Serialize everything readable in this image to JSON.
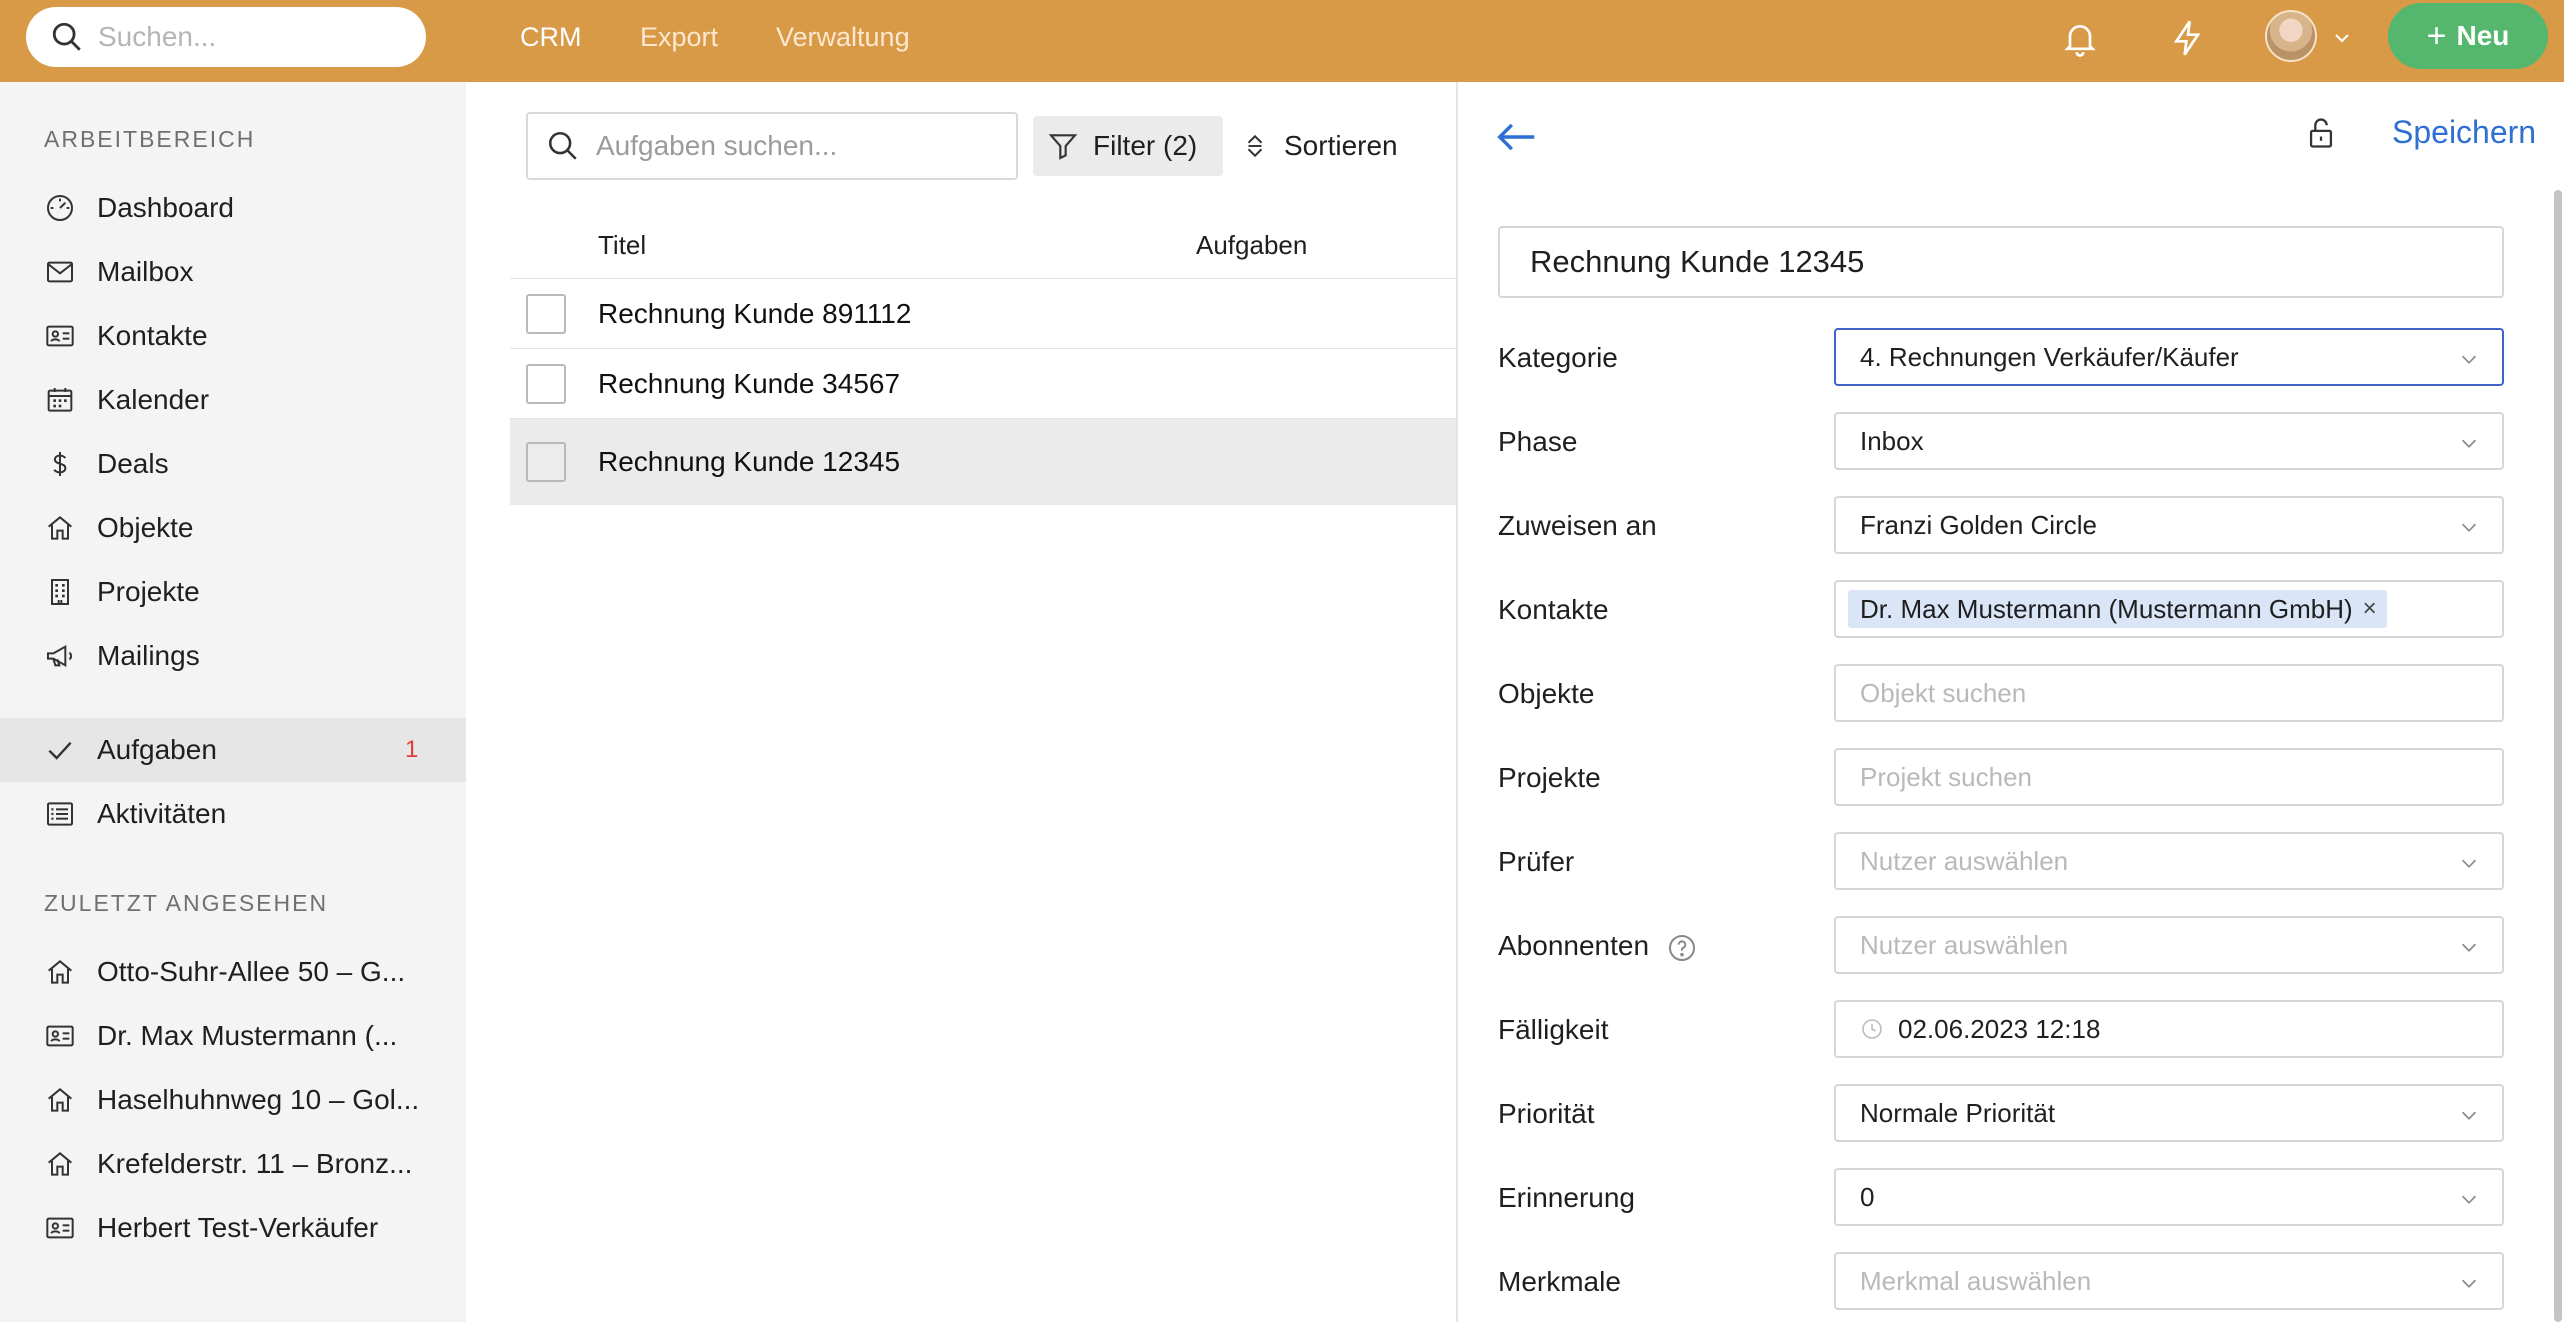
{
  "topbar": {
    "search_placeholder": "Suchen...",
    "nav": [
      "CRM",
      "Export",
      "Verwaltung"
    ],
    "new_button": "Neu"
  },
  "sidebar": {
    "workspace_title": "ARBEITBEREICH",
    "items": [
      {
        "label": "Dashboard",
        "icon": "dashboard-gauge-icon"
      },
      {
        "label": "Mailbox",
        "icon": "mail-icon"
      },
      {
        "label": "Kontakte",
        "icon": "contact-card-icon"
      },
      {
        "label": "Kalender",
        "icon": "calendar-icon"
      },
      {
        "label": "Deals",
        "icon": "dollar-icon"
      },
      {
        "label": "Objekte",
        "icon": "home-icon"
      },
      {
        "label": "Projekte",
        "icon": "building-icon"
      },
      {
        "label": "Mailings",
        "icon": "megaphone-icon"
      }
    ],
    "tasks": {
      "label": "Aufgaben",
      "badge": "1",
      "icon": "check-icon"
    },
    "activities": {
      "label": "Aktivitäten",
      "icon": "list-icon"
    },
    "recent_title": "ZULETZT ANGESEHEN",
    "recent": [
      {
        "label": "Otto-Suhr-Allee 50 – G...",
        "icon": "home-icon"
      },
      {
        "label": "Dr. Max Mustermann (...",
        "icon": "contact-card-icon"
      },
      {
        "label": "Haselhuhnweg 10 – Gol...",
        "icon": "home-icon"
      },
      {
        "label": "Krefelderstr. 11 – Bronz...",
        "icon": "home-icon"
      },
      {
        "label": "Herbert Test-Verkäufer",
        "icon": "contact-card-icon"
      }
    ]
  },
  "list": {
    "search_placeholder": "Aufgaben suchen...",
    "filter_label": "Filter (2)",
    "sort_label": "Sortieren",
    "columns": [
      "Titel",
      "Aufgaben"
    ],
    "rows": [
      "Rechnung Kunde 891112",
      "Rechnung Kunde 34567",
      "Rechnung Kunde 12345"
    ]
  },
  "detail": {
    "save_label": "Speichern",
    "title_value": "Rechnung Kunde 12345",
    "labels": {
      "kategorie": "Kategorie",
      "phase": "Phase",
      "zuweisen": "Zuweisen an",
      "kontakte": "Kontakte",
      "objekte": "Objekte",
      "projekte": "Projekte",
      "pruefer": "Prüfer",
      "abonnenten": "Abonnenten",
      "faelligkeit": "Fälligkeit",
      "prioritaet": "Priorität",
      "erinnerung": "Erinnerung",
      "merkmale": "Merkmale"
    },
    "values": {
      "kategorie": "4. Rechnungen Verkäufer/Käufer",
      "phase": "Inbox",
      "zuweisen": "Franzi Golden Circle",
      "kontakt_chip": "Dr. Max Mustermann (Mustermann GmbH)",
      "faelligkeit": "02.06.2023 12:18",
      "prioritaet": "Normale Priorität",
      "erinnerung": "0"
    },
    "placeholders": {
      "objekte": "Objekt suchen",
      "projekte": "Projekt suchen",
      "pruefer": "Nutzer auswählen",
      "abonnenten": "Nutzer auswählen",
      "merkmale": "Merkmal auswählen"
    }
  }
}
